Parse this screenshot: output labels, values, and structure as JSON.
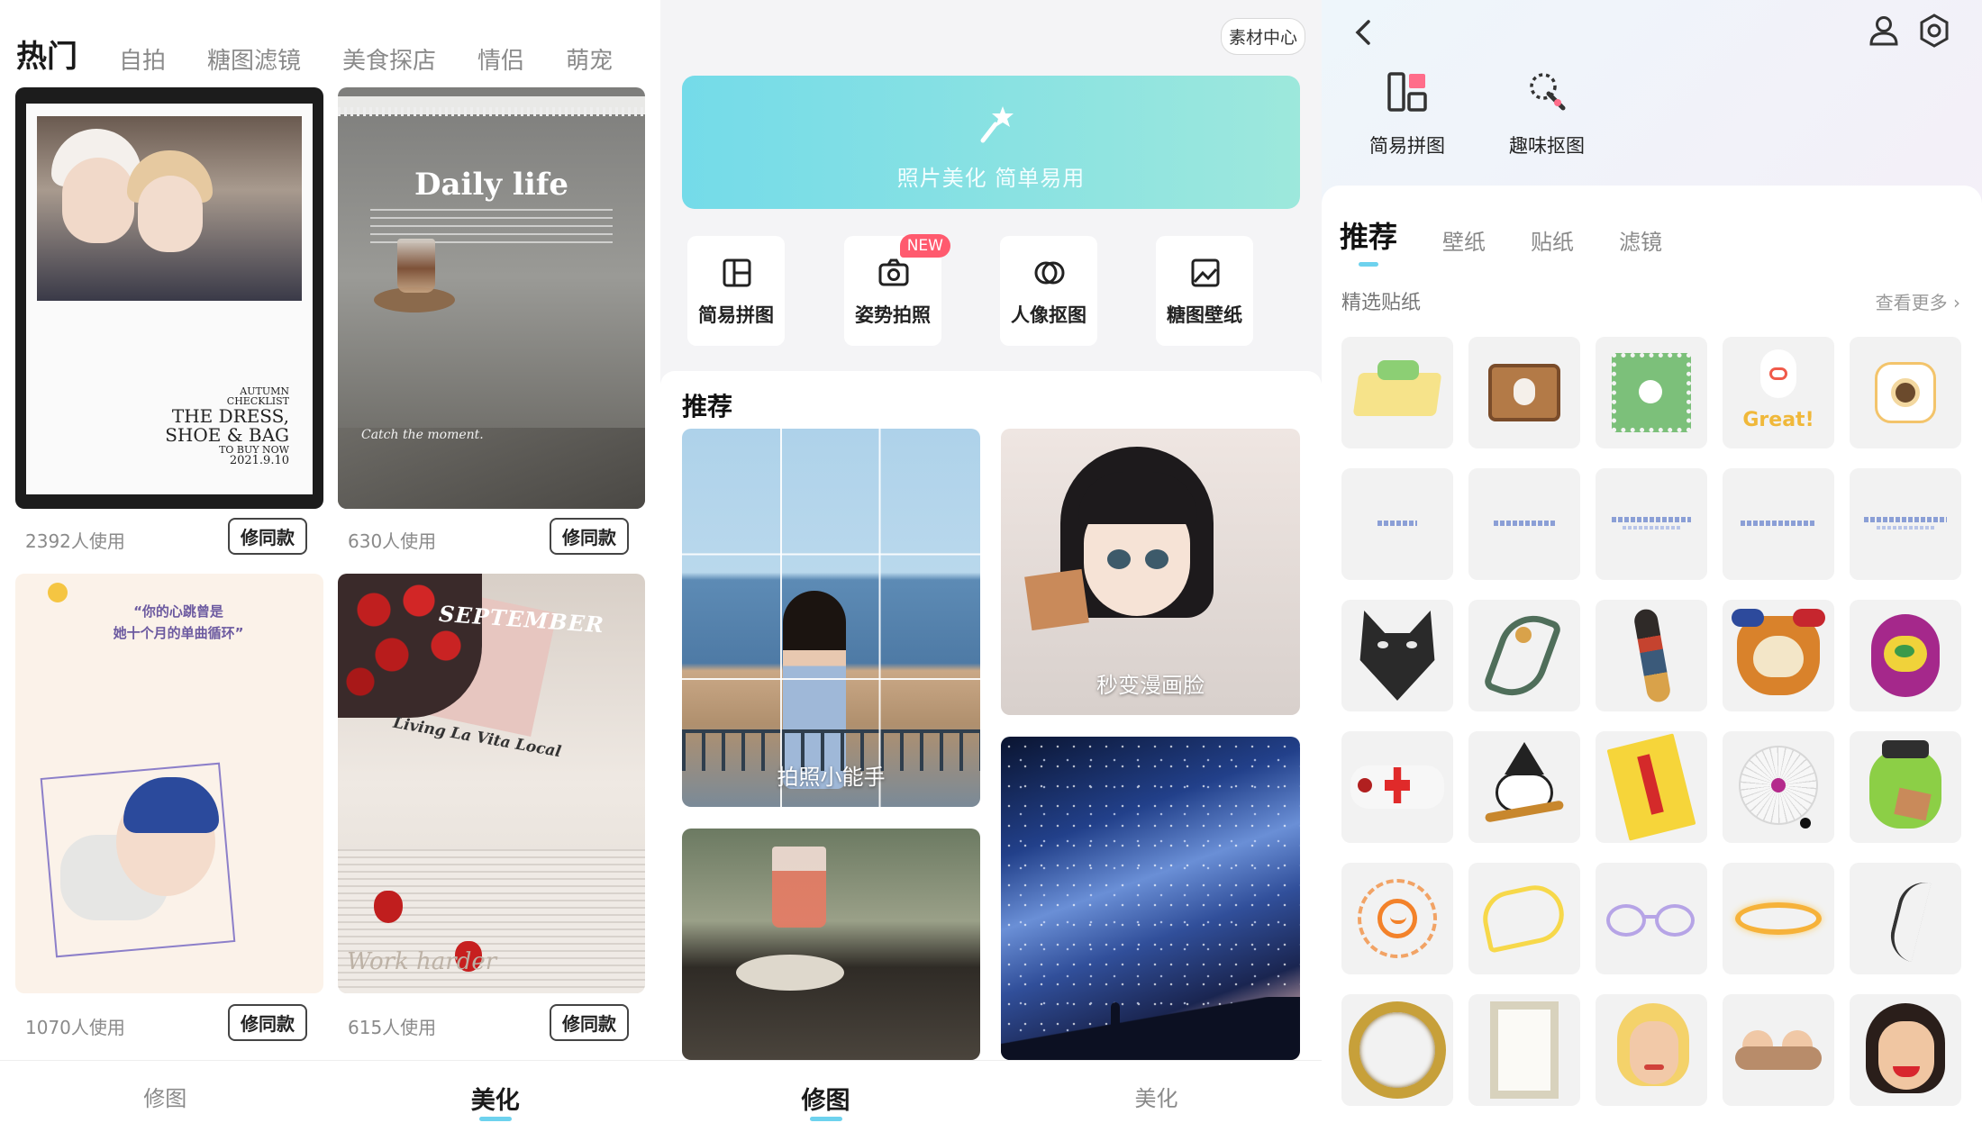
{
  "screen1": {
    "tabs": [
      "热门",
      "自拍",
      "糖图滤镜",
      "美食探店",
      "情侣",
      "萌宠"
    ],
    "cards": [
      {
        "usage": "2392人使用",
        "button": "修同款",
        "photo_text": [
          "AUTUMN",
          "CHECKLIST",
          "THE DRESS,",
          "SHOE & BAG",
          "TO BUY NOW",
          "2021.9.10"
        ]
      },
      {
        "usage": "630人使用",
        "button": "修同款",
        "photo_text": [
          "Daily life",
          "Catch the moment."
        ]
      },
      {
        "usage": "1070人使用",
        "button": "修同款",
        "photo_text": [
          "“你的心跳曾是",
          "她十个月的单曲循环”"
        ]
      },
      {
        "usage": "615人使用",
        "button": "修同款",
        "photo_text": [
          "SEPTEMBER",
          "Living La Vita Local",
          "Work harder"
        ]
      }
    ],
    "nav": [
      "修图",
      "美化"
    ],
    "active_nav": "美化"
  },
  "screen2": {
    "chip": "素材中心",
    "banner_text": "照片美化 简单易用",
    "tools": [
      {
        "label": "简易拼图",
        "icon": "collage-icon"
      },
      {
        "label": "姿势拍照",
        "icon": "camera-icon",
        "badge": "NEW"
      },
      {
        "label": "人像抠图",
        "icon": "cutout-icon"
      },
      {
        "label": "糖图壁纸",
        "icon": "wallpaper-icon"
      }
    ],
    "section_title": "推荐",
    "feed": [
      {
        "label": "拍照小能手"
      },
      {
        "label": "秒变漫画脸"
      },
      {
        "label": ""
      },
      {
        "label": ""
      }
    ],
    "nav": [
      "修图",
      "美化"
    ],
    "active_nav": "修图"
  },
  "screen3": {
    "tools": [
      {
        "label": "简易拼图",
        "icon": "collage-icon"
      },
      {
        "label": "趣味抠图",
        "icon": "magic-cutout-icon"
      }
    ],
    "tabs": [
      "推荐",
      "壁纸",
      "贴纸",
      "滤镜"
    ],
    "section_title": "精选贴纸",
    "see_more": "查看更多 ›",
    "sticker_text": {
      "great": "Great!"
    },
    "stickers": [
      "picnic-basket",
      "suitcase-bunny",
      "stamp-flowers",
      "bunny-great",
      "camera-sticker",
      "text-sticker-1",
      "text-sticker-2",
      "text-sticker-3",
      "text-sticker-4",
      "text-sticker-5",
      "wolf",
      "dragon",
      "arm-tattoo",
      "skull-tattoo",
      "monster-tattoo",
      "bandage-cross",
      "witch-cat",
      "talisman",
      "spider-web",
      "green-monster",
      "doodle-sun",
      "doodle-wing",
      "doodle-glasses",
      "doodle-halo",
      "doodle-line",
      "gold-ring-frame",
      "rect-frame",
      "vintage-lady",
      "cherubs",
      "retro-woman"
    ],
    "colors": {
      "accent": "#6dd2ee",
      "badge": "#ff5a6e"
    }
  }
}
